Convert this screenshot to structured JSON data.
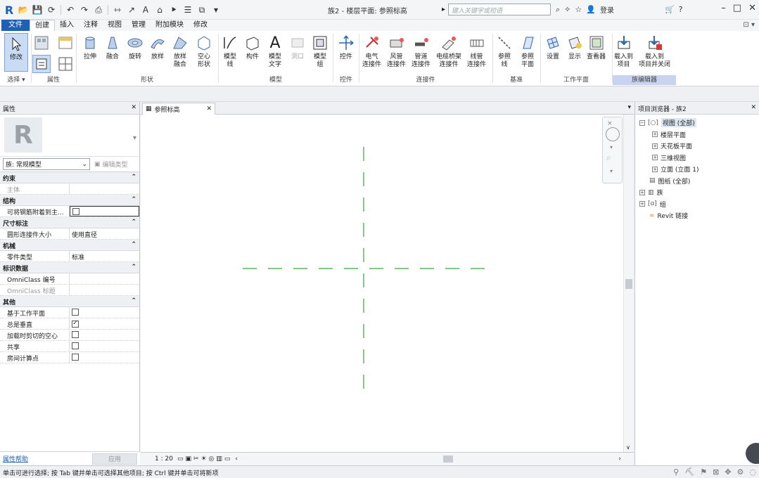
{
  "title": {
    "text": "族2 - 楼层平面: 参照标高",
    "search_placeholder": "键入关键字或短语",
    "login": "登录"
  },
  "menu": {
    "items": [
      "文件",
      "创建",
      "插入",
      "注释",
      "视图",
      "管理",
      "附加模块",
      "修改"
    ]
  },
  "ribbon": {
    "modify": "修改",
    "select_label": "选择 ▾",
    "properties_label": "属性",
    "shape_tools": [
      {
        "l1": "拉伸",
        "l2": ""
      },
      {
        "l1": "融合",
        "l2": ""
      },
      {
        "l1": "旋转",
        "l2": ""
      },
      {
        "l1": "放样",
        "l2": ""
      },
      {
        "l1": "放样",
        "l2": "融合"
      },
      {
        "l1": "空心",
        "l2": "形状"
      }
    ],
    "shape_label": "形状",
    "model_tools": [
      {
        "l1": "模型",
        "l2": "线"
      },
      {
        "l1": "构件",
        "l2": ""
      },
      {
        "l1": "模型",
        "l2": "文字"
      },
      {
        "l1": "洞口",
        "l2": ""
      },
      {
        "l1": "模型",
        "l2": "组"
      }
    ],
    "model_label": "模型",
    "control_tool": "控件",
    "control_label": "控件",
    "connector_tools": [
      {
        "l1": "电气",
        "l2": "连接件"
      },
      {
        "l1": "风管",
        "l2": "连接件"
      },
      {
        "l1": "管道",
        "l2": "连接件"
      },
      {
        "l1": "电缆桥架",
        "l2": "连接件"
      },
      {
        "l1": "线管",
        "l2": "连接件"
      }
    ],
    "connector_label": "连接件",
    "datum_tools": [
      {
        "l1": "参照",
        "l2": "线"
      },
      {
        "l1": "参照",
        "l2": "平面"
      }
    ],
    "datum_label": "基准",
    "workplane_tools": [
      {
        "l1": "设置",
        "l2": ""
      },
      {
        "l1": "显示",
        "l2": ""
      },
      {
        "l1": "查看器",
        "l2": ""
      }
    ],
    "workplane_label": "工作平面",
    "family_tools": [
      {
        "l1": "载入到",
        "l2": "项目"
      },
      {
        "l1": "载入到",
        "l2": "项目并关闭"
      }
    ],
    "family_label": "族编辑器"
  },
  "properties": {
    "title": "属性",
    "type_name": "族: 常规模型",
    "edit_type": "编辑类型",
    "groups": [
      {
        "name": "约束",
        "rows": [
          {
            "k": "主体",
            "v": "",
            "gray": true
          }
        ]
      },
      {
        "name": "结构",
        "rows": [
          {
            "k": "可将钢筋附着到主...",
            "v": "",
            "check": "input"
          }
        ]
      },
      {
        "name": "尺寸标注",
        "rows": [
          {
            "k": "圆形连接件大小",
            "v": "使用直径"
          }
        ]
      },
      {
        "name": "机械",
        "rows": [
          {
            "k": "零件类型",
            "v": "标准"
          }
        ]
      },
      {
        "name": "标识数据",
        "rows": [
          {
            "k": "OmniClass 编号",
            "v": ""
          },
          {
            "k": "OmniClass 标题",
            "v": "",
            "gray": true
          }
        ]
      },
      {
        "name": "其他",
        "rows": [
          {
            "k": "基于工作平面",
            "v": "",
            "check": "off"
          },
          {
            "k": "总是垂直",
            "v": "",
            "check": "on"
          },
          {
            "k": "加载时剪切的空心",
            "v": "",
            "check": "off"
          },
          {
            "k": "共享",
            "v": "",
            "check": "off"
          },
          {
            "k": "房间计算点",
            "v": "",
            "check": "off"
          }
        ]
      }
    ],
    "help": "属性帮助",
    "apply": "应用"
  },
  "view": {
    "tab": "参照标高",
    "scale": "1 : 20"
  },
  "browser": {
    "title": "项目浏览器 - 族2",
    "tree": [
      {
        "label": "视图 (全部)",
        "exp": "−",
        "lvl": 0,
        "sel": true
      },
      {
        "label": "楼层平面",
        "exp": "+",
        "lvl": 1
      },
      {
        "label": "天花板平面",
        "exp": "+",
        "lvl": 1
      },
      {
        "label": "三维视图",
        "exp": "+",
        "lvl": 1
      },
      {
        "label": "立面 (立面 1)",
        "exp": "+",
        "lvl": 1
      },
      {
        "label": "图纸 (全部)",
        "exp": "",
        "lvl": 0
      },
      {
        "label": "族",
        "exp": "+",
        "lvl": 0
      },
      {
        "label": "组",
        "exp": "+",
        "lvl": 0
      },
      {
        "label": "Revit 链接",
        "exp": "",
        "lvl": 0
      }
    ]
  },
  "status": {
    "text": "单击可进行选择; 按 Tab 键并单击可选择其他项目; 按 Ctrl 键并单击可将新项"
  },
  "colors": {
    "accent": "#1f5fb4",
    "guide": "#3aa33a"
  }
}
